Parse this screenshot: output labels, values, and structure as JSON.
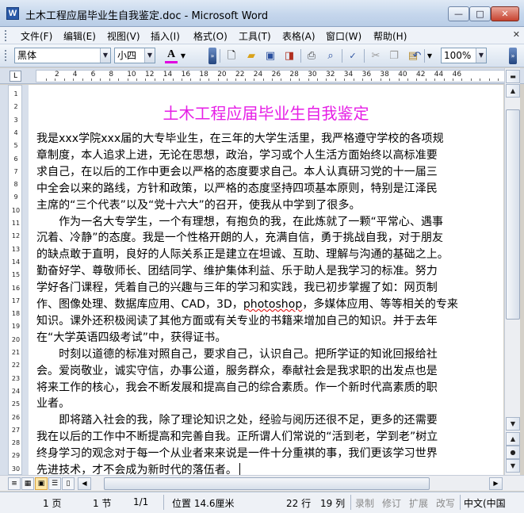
{
  "window": {
    "title": "土木工程应届毕业生自我鉴定.doc - Microsoft Word",
    "app_icon": "W",
    "minimize": "—",
    "maximize": "□",
    "close": "✕"
  },
  "menu": {
    "items": [
      "文件(F)",
      "编辑(E)",
      "视图(V)",
      "插入(I)",
      "格式(O)",
      "工具(T)",
      "表格(A)",
      "窗口(W)",
      "帮助(H)"
    ],
    "close_doc": "✕"
  },
  "toolbar": {
    "font_name": "黑体",
    "font_size": "小四",
    "font_color_label": "A",
    "font_color": "#e000e0",
    "zoom": "100%",
    "icons": [
      "new-icon",
      "open-icon",
      "save-icon",
      "permission-icon",
      "print-icon",
      "print-preview-icon",
      "spelling-icon",
      "cut-icon",
      "copy-icon",
      "paste-icon",
      "undo-icon"
    ]
  },
  "ruler": {
    "tab_selector": "L",
    "numbers": [
      "2",
      "4",
      "6",
      "8",
      "10",
      "12",
      "14",
      "16",
      "18",
      "20",
      "22",
      "24",
      "26",
      "28",
      "30",
      "32",
      "34",
      "36",
      "38",
      "40",
      "42",
      "44",
      "46"
    ],
    "vertical_numbers": [
      "1",
      "2",
      "3",
      "4",
      "5",
      "6",
      "7",
      "8",
      "9",
      "10",
      "11",
      "12",
      "13",
      "14",
      "15",
      "16",
      "17",
      "18",
      "19",
      "20",
      "21",
      "22",
      "23",
      "24",
      "25",
      "26",
      "27",
      "28",
      "29",
      "30"
    ]
  },
  "document": {
    "title": "土木工程应届毕业生自我鉴定",
    "title_color": "#e61ee6",
    "lines": [
      "我是xxx学院xxx届的大专毕业生，在三年的大学生活里，我严格遵守学校的各项规",
      "章制度，本人追求上进，无论在思想，政治，学习或个人生活方面始终以高标准要",
      "求自己，在以后的工作中更会以严格的态度要求自己。本人认真研习党的十一届三",
      "中全会以来的路线，方针和政策，以严格的态度坚持四项基本原则，特别是江泽民",
      "主席的“三个代表”以及“党十六大”的召开，使我从中学到了很多。",
      "　　作为一名大专学生，一个有理想，有抱负的我，在此炼就了一颗“平常心、遇事",
      "沉着、冷静”的态度。我是一个性格开朗的人，充满自信，勇于挑战自我，对于朋友",
      "的缺点敢于直明，良好的人际关系正是建立在坦诚、互助、理解与沟通的基础之上。",
      "勤奋好学、尊敬师长、团结同学、维护集体利益、乐于助人是我学习的标准。努力",
      "学好各门课程，凭着自己的兴趣与三年的学习和实践，我已初步掌握了如：网页制",
      "作、图像处理、数据库应用、CAD，3D，photoshop，多媒体应用、等等相关的专来",
      "知识。课外还积极阅读了其他方面或有关专业的书籍来增加自己的知识。并于去年",
      "在“大学英语四级考试”中，获得证书。",
      "　　时刻以道德的标准对照自己，要求自己，认识自己。把所学证的知讹回报给社",
      "会。爱岗敬业，诚实守信，办事公道，服务群众，奉献社会是我求职的出发点也是",
      "将来工作的核心，我会不断发展和提高自己的综合素质。作一个新时代高素质的职",
      "业者。",
      "　　即将踏入社会的我，除了理论知识之处，经验与阅历还很不足，更多的还需要",
      "我在以后的工作中不断提高和完善自我。正所谓人们常说的“活到老，学到老”树立",
      "终身学习的观念对于每一个从业者来来说是一件十分重褀的事，我们更该学习世界",
      "先进技术，才不会成为新时代的落伍者。"
    ],
    "squiggle_word": "photoshop"
  },
  "status": {
    "page": "1 页",
    "section": "1 节",
    "page_of": "1/1",
    "position": "位置 14.6厘米",
    "line": "22 行",
    "column": "19 列",
    "rec": "录制",
    "trk": "修订",
    "ext": "扩展",
    "ovr": "改写",
    "language": "中文(中国"
  }
}
